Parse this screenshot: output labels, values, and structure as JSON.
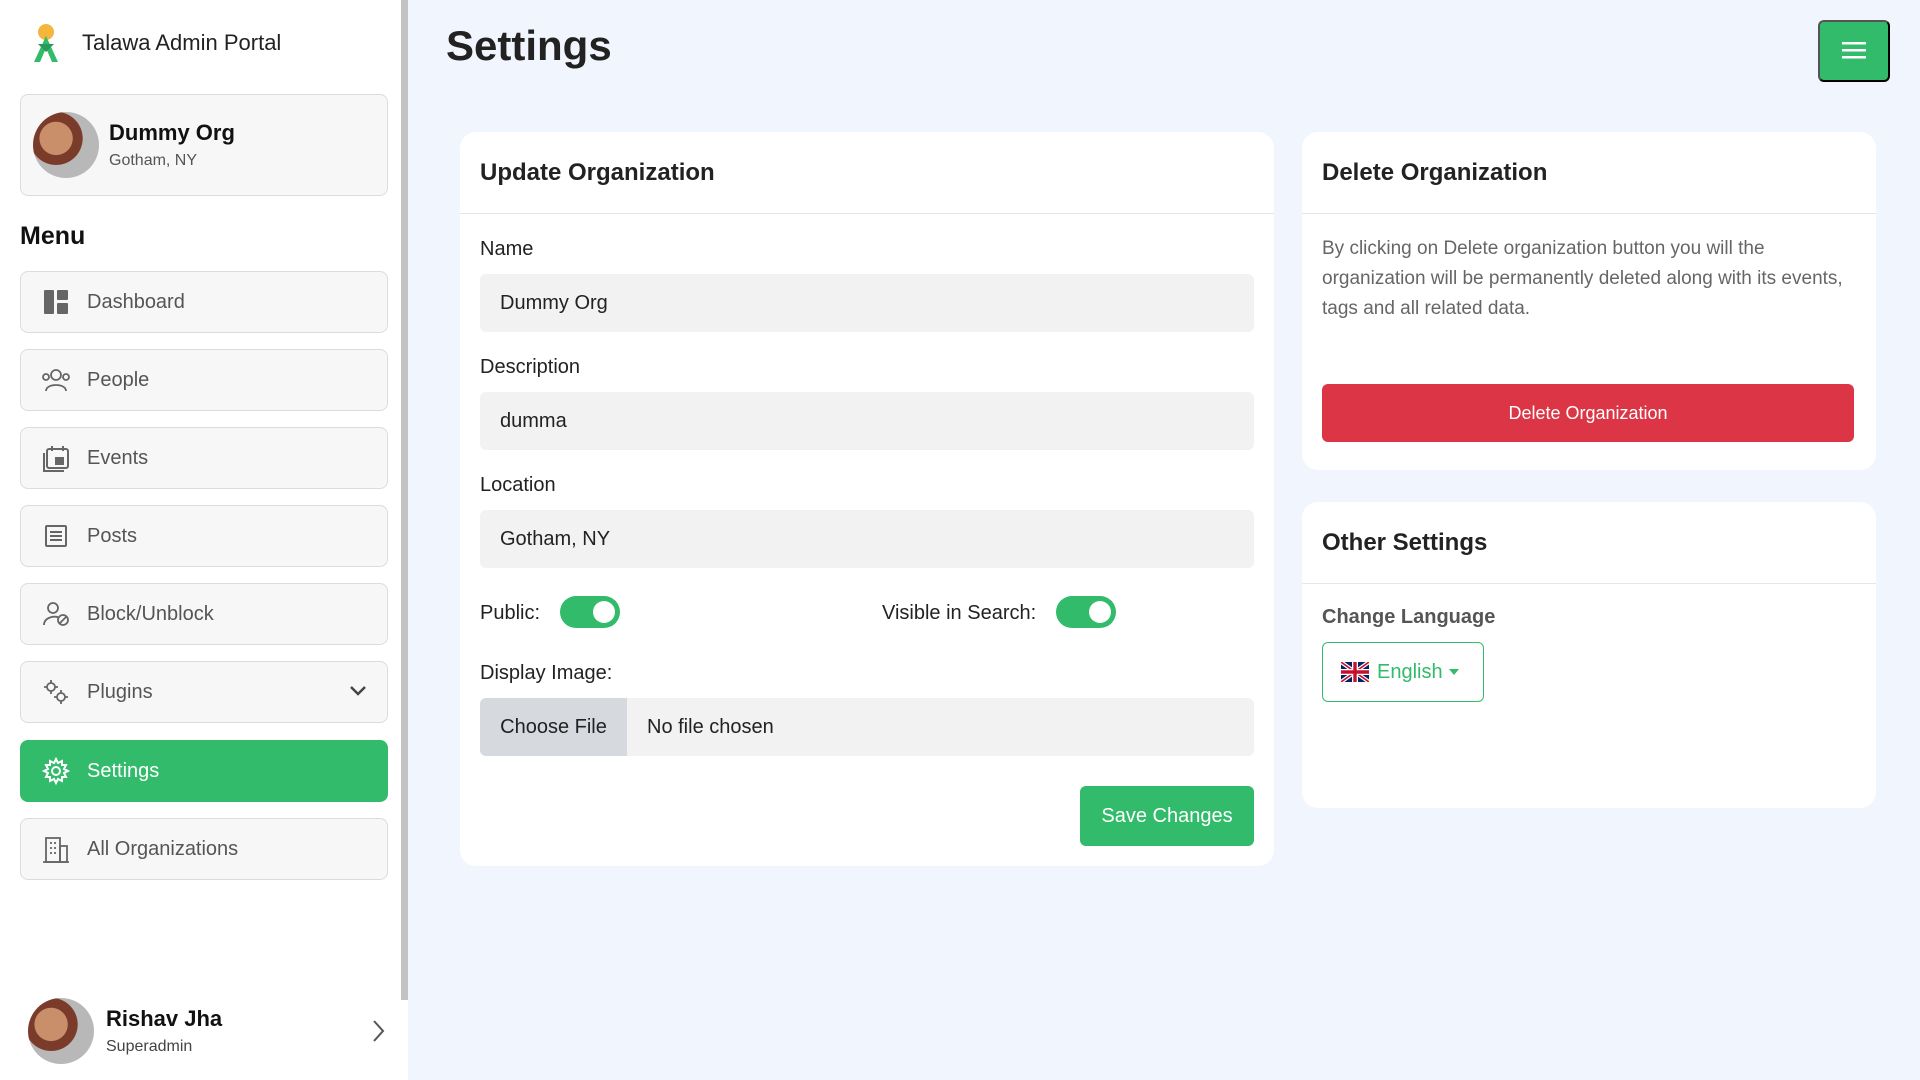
{
  "brand": {
    "title": "Talawa Admin Portal",
    "icon": "talawa-logo"
  },
  "org": {
    "name": "Dummy Org",
    "location": "Gotham, NY"
  },
  "menu": {
    "heading": "Menu",
    "items": [
      {
        "label": "Dashboard",
        "icon": "dashboard-icon"
      },
      {
        "label": "People",
        "icon": "people-icon"
      },
      {
        "label": "Events",
        "icon": "events-icon"
      },
      {
        "label": "Posts",
        "icon": "posts-icon"
      },
      {
        "label": "Block/Unblock",
        "icon": "block-user-icon"
      },
      {
        "label": "Plugins",
        "icon": "plugins-icon"
      },
      {
        "label": "Settings",
        "icon": "settings-icon",
        "active": true
      },
      {
        "label": "All Organizations",
        "icon": "building-icon"
      }
    ]
  },
  "user": {
    "name": "Rishav Jha",
    "role": "Superadmin"
  },
  "page": {
    "title": "Settings"
  },
  "update": {
    "heading": "Update Organization",
    "name_label": "Name",
    "name_value": "Dummy Org",
    "description_label": "Description",
    "description_value": "dumma",
    "location_label": "Location",
    "location_value": "Gotham, NY",
    "public_label": "Public:",
    "public_on": true,
    "visible_label": "Visible in Search:",
    "visible_on": true,
    "display_image_label": "Display Image:",
    "choose_file_label": "Choose File",
    "file_status": "No file chosen",
    "save_label": "Save Changes"
  },
  "delete": {
    "heading": "Delete Organization",
    "description": "By clicking on Delete organization button you will the organization will be permanently deleted along with its events, tags and all related data.",
    "button_label": "Delete Organization"
  },
  "other": {
    "heading": "Other Settings",
    "language_label": "Change Language",
    "language_value": "English",
    "language_flag": "uk-flag-icon"
  },
  "colors": {
    "accent": "#31bb6b",
    "danger": "#dc3545",
    "background": "#f1f5fd"
  }
}
